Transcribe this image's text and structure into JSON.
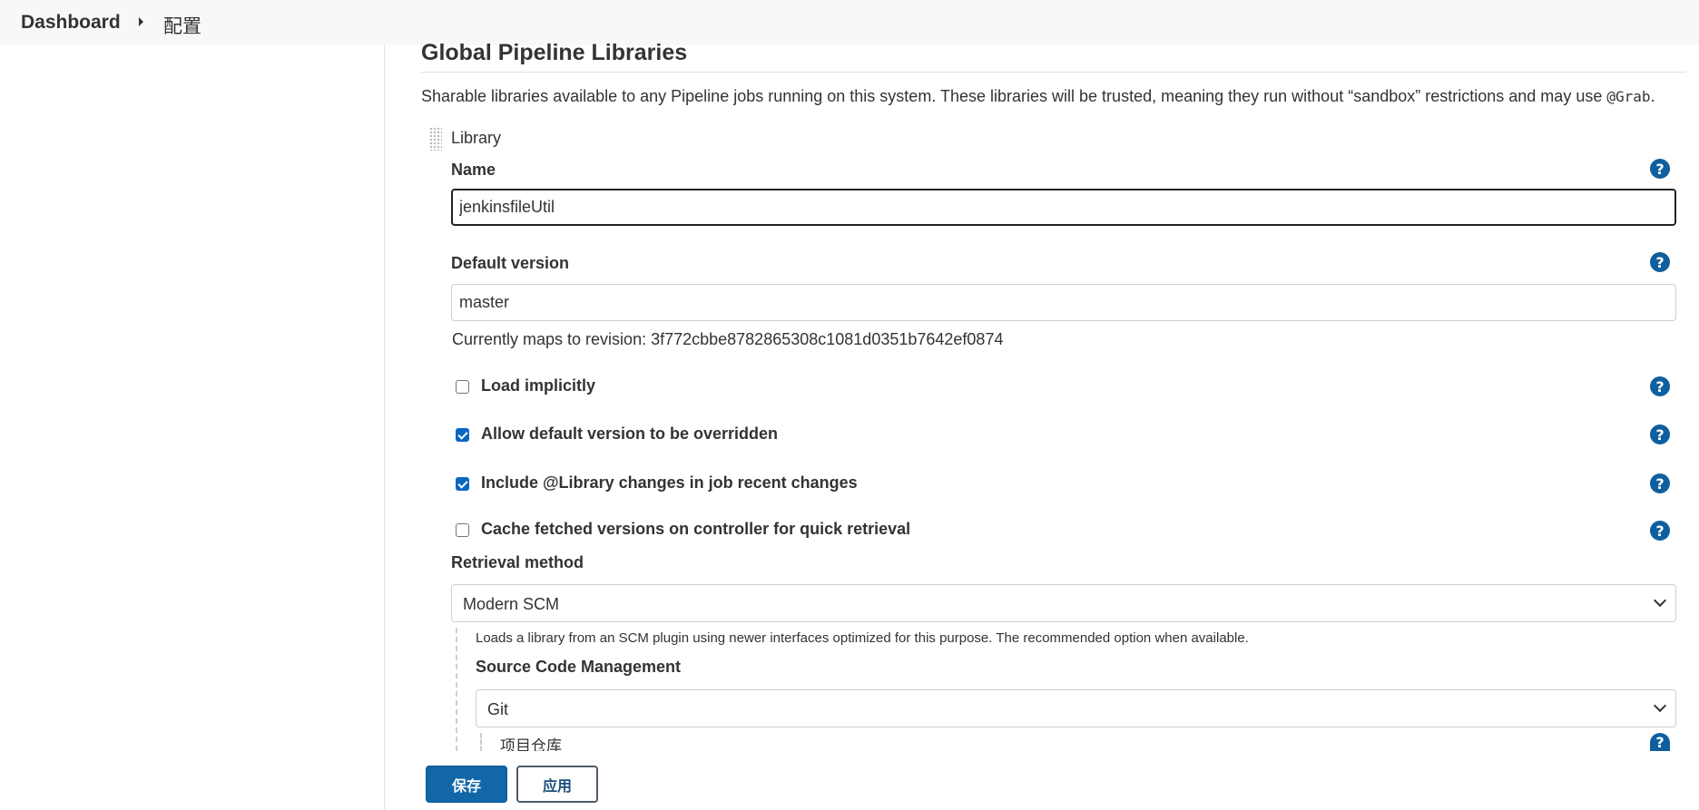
{
  "breadcrumb": {
    "dashboard": "Dashboard",
    "current": "配置"
  },
  "section": {
    "title": "Global Pipeline Libraries",
    "description_prefix": "Sharable libraries available to any Pipeline jobs running on this system. These libraries will be trusted, meaning they run without “sandbox” restrictions and may use ",
    "description_code": "@Grab",
    "description_suffix": "."
  },
  "library": {
    "label": "Library",
    "name_label": "Name",
    "name_value": "jenkinsfileUtil",
    "default_version_label": "Default version",
    "default_version_value": "master",
    "revision_text": "Currently maps to revision: 3f772cbbe8782865308c1081d0351b7642ef0874",
    "options": [
      {
        "label": "Load implicitly",
        "checked": false
      },
      {
        "label": "Allow default version to be overridden",
        "checked": true
      },
      {
        "label": "Include @Library changes in job recent changes",
        "checked": true
      },
      {
        "label": "Cache fetched versions on controller for quick retrieval",
        "checked": false
      }
    ],
    "retrieval_label": "Retrieval method",
    "retrieval_value": "Modern SCM",
    "retrieval_desc": "Loads a library from an SCM plugin using newer interfaces optimized for this purpose. The recommended option when available.",
    "scm_label": "Source Code Management",
    "scm_value": "Git",
    "repo_label": "项目仓库"
  },
  "help_icon": "?",
  "actions": {
    "save": "保存",
    "apply": "应用"
  },
  "colors": {
    "primary": "#1167a8",
    "help": "#0f5f9e",
    "checkbox": "#0b66c3"
  }
}
